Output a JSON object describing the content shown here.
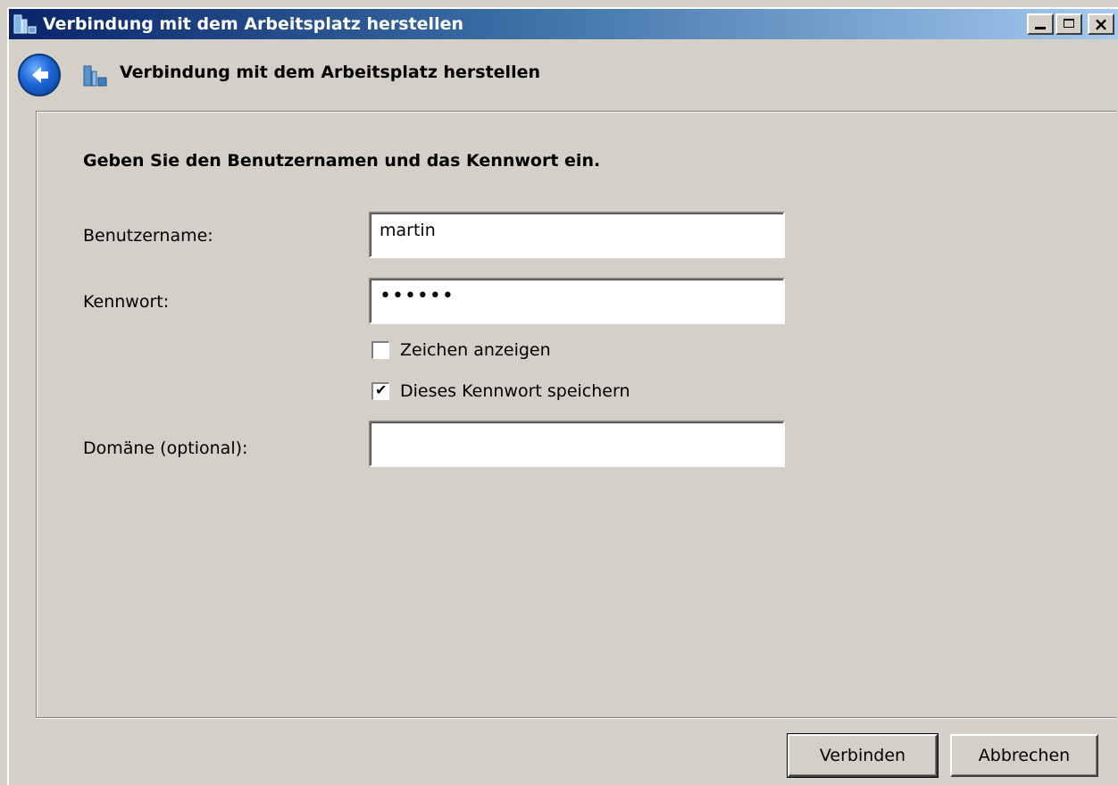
{
  "window": {
    "title": "Verbindung mit dem Arbeitsplatz herstellen"
  },
  "nav": {
    "title": "Verbindung mit dem Arbeitsplatz herstellen"
  },
  "form": {
    "heading": "Geben Sie den Benutzernamen und das Kennwort ein.",
    "username_label": "Benutzername:",
    "username_value": "martin",
    "password_label": "Kennwort:",
    "password_value": "••••••",
    "show_chars_label": "Zeichen anzeigen",
    "show_chars_checked": false,
    "save_password_label": "Dieses Kennwort speichern",
    "save_password_checked": true,
    "domain_label": "Domäne (optional):",
    "domain_value": ""
  },
  "buttons": {
    "connect": "Verbinden",
    "cancel": "Abbrechen"
  },
  "colors": {
    "titlebar_start": "#0a246a",
    "titlebar_end": "#a6caf0",
    "dialog_bg": "#d4d0c8"
  }
}
